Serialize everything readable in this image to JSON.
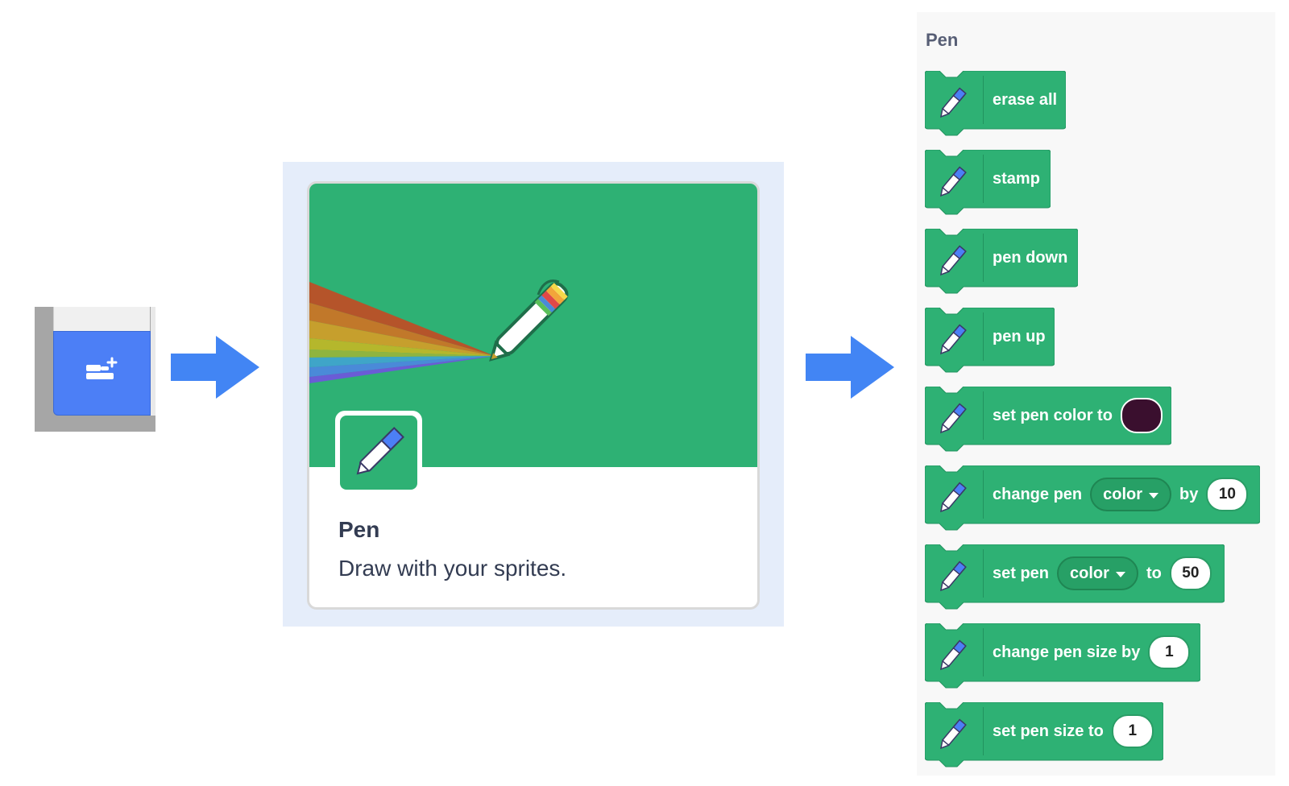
{
  "extension_button": {
    "icon": "add-extension-icon",
    "color": "#4c7ff6"
  },
  "card": {
    "title": "Pen",
    "description": "Draw with your sprites.",
    "banner_color": "#2eb174"
  },
  "palette": {
    "title": "Pen",
    "block_color": "#2eb174",
    "blocks": [
      {
        "label": "erase all"
      },
      {
        "label": "stamp"
      },
      {
        "label": "pen down"
      },
      {
        "label": "pen up"
      },
      {
        "label": "set pen color to",
        "swatch": "#3a0f2e"
      },
      {
        "label": "change pen",
        "dropdown": "color",
        "label2": "by",
        "value": "10"
      },
      {
        "label": "set pen",
        "dropdown": "color",
        "label2": "to",
        "value": "50"
      },
      {
        "label": "change pen size by",
        "value": "1"
      },
      {
        "label": "set pen size to",
        "value": "1"
      }
    ]
  }
}
